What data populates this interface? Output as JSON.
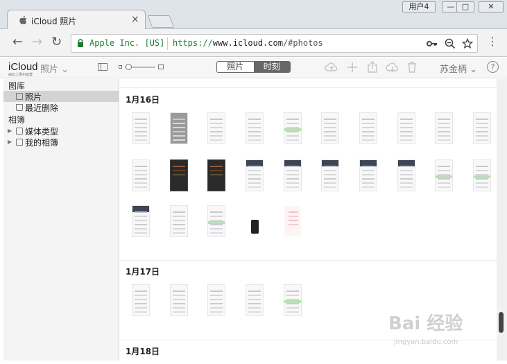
{
  "window": {
    "tab_title": "iCloud 照片",
    "tab_close": "×",
    "user_button": "用户4",
    "minimize": "—",
    "maximize": "□",
    "close": "✕"
  },
  "address_bar": {
    "back": "←",
    "forward": "→",
    "reload": "↻",
    "site_identity": "Apple Inc. [US]",
    "url_scheme": "https://",
    "url_host": "www.icloud.com",
    "url_path": "/#photos",
    "key_icon": "key-icon",
    "zoom_icon": "magnifier-icon",
    "star_icon": "star-icon",
    "menu": "⋮"
  },
  "app_header": {
    "brand": "iCloud",
    "brand_sub": "由云上贵州运营",
    "app_name": "照片",
    "app_menu_arrow": "⌄",
    "view_tabs": [
      {
        "label": "照片",
        "active": false
      },
      {
        "label": "时刻",
        "active": true
      }
    ],
    "account_name": "苏金柄",
    "account_arrow": "⌄",
    "help": "?"
  },
  "sidebar": {
    "library_heading": "图库",
    "library_items": [
      {
        "label": "照片",
        "selected": true
      },
      {
        "label": "最近删除",
        "selected": false
      }
    ],
    "albums_heading": "相簿",
    "album_items": [
      {
        "label": "媒体类型",
        "arrow": "▶"
      },
      {
        "label": "我的相簿",
        "arrow": "▶"
      }
    ]
  },
  "moments": [
    {
      "date": "1月16日"
    },
    {
      "date": "1月17日"
    },
    {
      "date": "1月18日"
    }
  ],
  "watermark": {
    "text": "Bai 经验",
    "sub": "jingyan.baidu.com"
  },
  "colors": {
    "secure_green": "#1a7b31",
    "segment_active": "#666666",
    "sidebar_selected": "#d3d3d3"
  }
}
